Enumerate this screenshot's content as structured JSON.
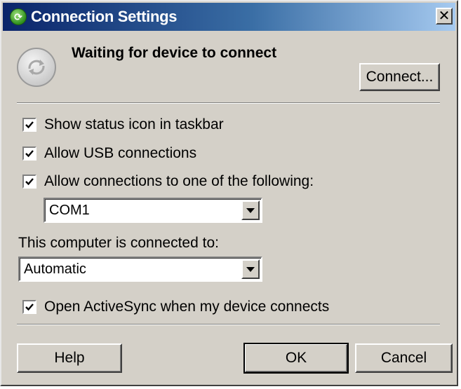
{
  "window": {
    "title": "Connection Settings",
    "title_icon": "activesync-green-icon",
    "close_glyph": "✕"
  },
  "status": {
    "icon": "sync-arrows-icon",
    "text": "Waiting for device to connect",
    "connect_label": "Connect..."
  },
  "options": {
    "show_status_icon": {
      "label": "Show status icon in taskbar",
      "checked": true
    },
    "allow_usb": {
      "label": "Allow USB connections",
      "checked": true
    },
    "allow_serial": {
      "label": "Allow connections to one of the following:",
      "checked": true
    },
    "serial_port": {
      "value": "COM1"
    }
  },
  "connected_to": {
    "label": "This computer is connected to:",
    "value": "Automatic"
  },
  "open_activesync": {
    "label": "Open ActiveSync when my device connects",
    "checked": true
  },
  "buttons": {
    "help": "Help",
    "ok": "OK",
    "cancel": "Cancel"
  }
}
